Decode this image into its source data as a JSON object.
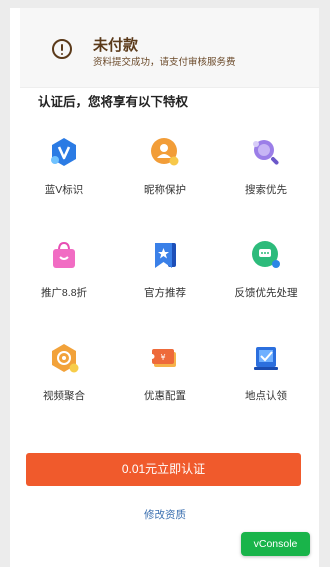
{
  "status": {
    "title": "未付款",
    "subtitle": "资料提交成功，请支付审核服务费"
  },
  "section_title": "认证后，您将享有以下特权",
  "benefits": [
    {
      "label": "蓝V标识",
      "icon": "blue-v-badge-icon"
    },
    {
      "label": "昵称保护",
      "icon": "nickname-protect-icon"
    },
    {
      "label": "搜索优先",
      "icon": "search-priority-icon"
    },
    {
      "label": "推广8.8折",
      "icon": "shopping-bag-icon"
    },
    {
      "label": "官方推荐",
      "icon": "bookmark-star-icon"
    },
    {
      "label": "反馈优先处理",
      "icon": "feedback-chat-icon"
    },
    {
      "label": "视频聚合",
      "icon": "video-aggregate-icon"
    },
    {
      "label": "优惠配置",
      "icon": "coupon-icon"
    },
    {
      "label": "地点认领",
      "icon": "location-claim-icon"
    }
  ],
  "cta_label": "0.01元立即认证",
  "modify_link": "修改资质",
  "vconsole_label": "vConsole",
  "colors": {
    "accent": "#f05a2c",
    "link": "#3a6fb0",
    "status_text": "#5b3a1a",
    "vconsole": "#19b44a"
  }
}
